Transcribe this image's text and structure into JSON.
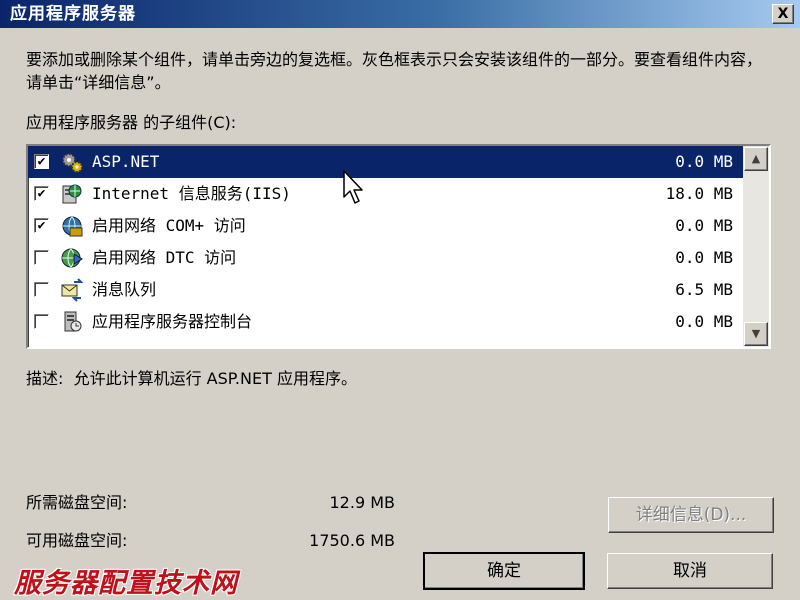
{
  "window": {
    "title": "应用程序服务器",
    "close_glyph": "X"
  },
  "instructions": "要添加或删除某个组件，请单击旁边的复选框。灰色框表示只会安装该组件的一部分。要查看组件内容，请单击“详细信息”。",
  "subcomponents_label": "应用程序服务器 的子组件(C):",
  "components": [
    {
      "name": "ASP.NET",
      "size": "0.0 MB",
      "checked": true,
      "selected": true,
      "icon": "gears-icon"
    },
    {
      "name": "Internet 信息服务(IIS)",
      "size": "18.0 MB",
      "checked": true,
      "selected": false,
      "icon": "iis-icon"
    },
    {
      "name": "启用网络 COM+ 访问",
      "size": "0.0 MB",
      "checked": true,
      "selected": false,
      "icon": "com-network-icon"
    },
    {
      "name": "启用网络 DTC 访问",
      "size": "0.0 MB",
      "checked": false,
      "selected": false,
      "icon": "dtc-network-icon"
    },
    {
      "name": "消息队列",
      "size": "6.5 MB",
      "checked": false,
      "selected": false,
      "icon": "message-queue-icon"
    },
    {
      "name": "应用程序服务器控制台",
      "size": "0.0 MB",
      "checked": false,
      "selected": false,
      "icon": "server-console-icon"
    }
  ],
  "description": {
    "label": "描述:",
    "text": "允许此计算机运行 ASP.NET 应用程序。"
  },
  "disk": {
    "required_label": "所需磁盘空间:",
    "required_value": "12.9 MB",
    "available_label": "可用磁盘空间:",
    "available_value": "1750.6 MB"
  },
  "buttons": {
    "details": "详细信息(D)...",
    "ok": "确定",
    "cancel": "取消"
  },
  "watermark": "服务器配置技术网",
  "colors": {
    "selection": "#0a246a",
    "face": "#d4d0c8",
    "watermark": "#c0101a"
  }
}
